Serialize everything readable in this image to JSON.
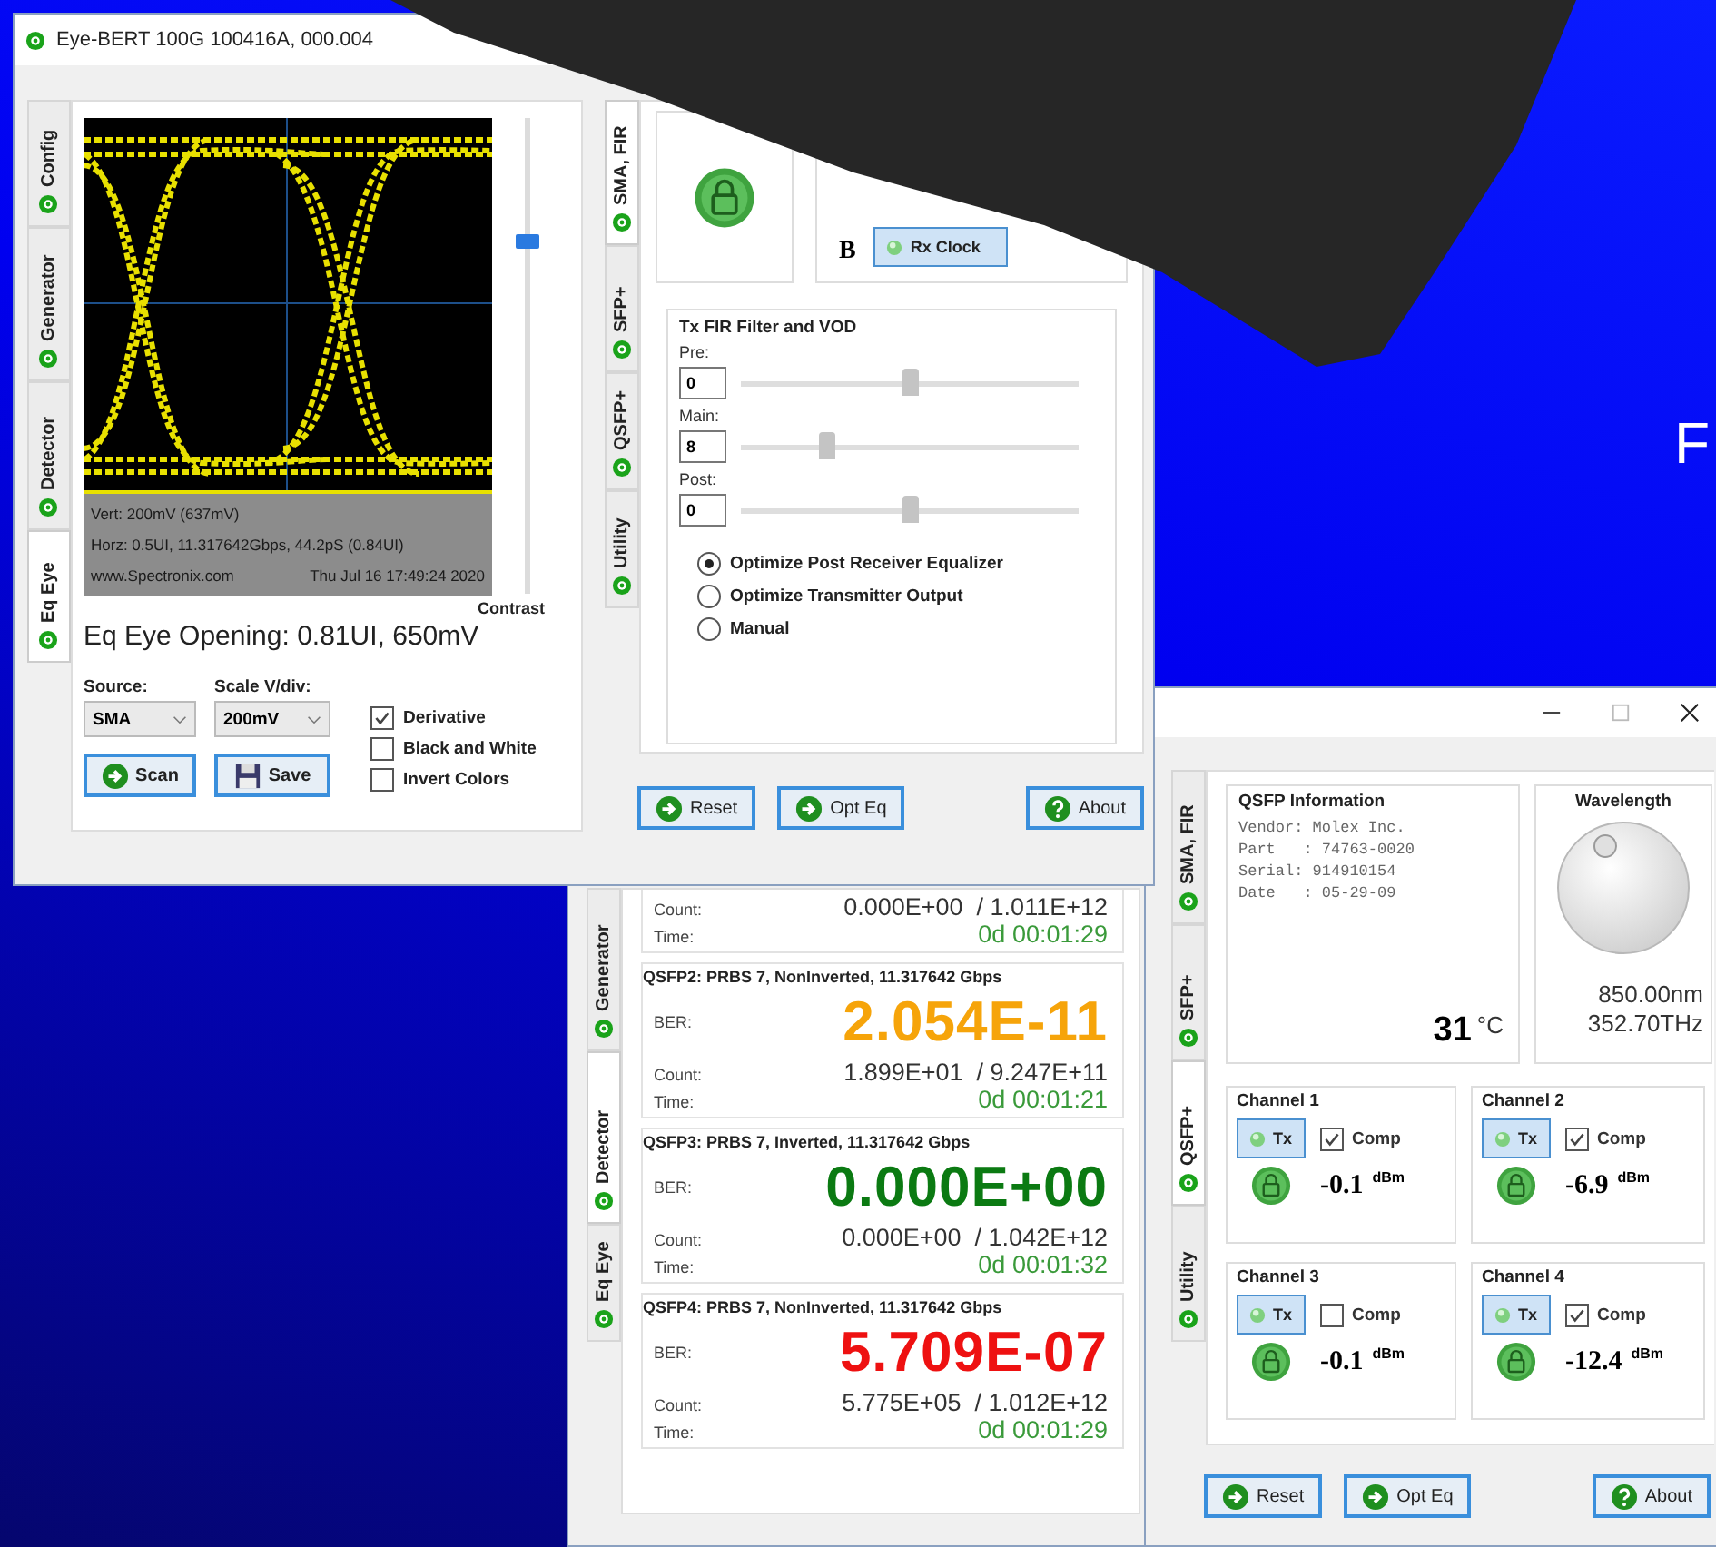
{
  "eye_bert_window": {
    "title": "Eye-BERT 100G 100416A, 000.004",
    "left_tabs": [
      {
        "label": "Config",
        "selected": false
      },
      {
        "label": "Generator",
        "selected": false
      },
      {
        "label": "Detector",
        "selected": false
      },
      {
        "label": "Eq Eye",
        "selected": true
      }
    ],
    "eye_info": [
      "Vert: 200mV (637mV)",
      "Horz: 0.5UI, 11.317642Gbps, 44.2pS (0.84UI)"
    ],
    "eye_footer": [
      "www.Spectronix.com",
      "Thu Jul 16 17:49:24 2020"
    ],
    "contrast": {
      "label": "Contrast",
      "level": 0.74
    },
    "eye_opening": "Eq Eye Opening:  0.81UI, 650mV",
    "selects": [
      {
        "label": "Source:",
        "value": "SMA"
      },
      {
        "label": "Scale V/div:",
        "value": "200mV"
      }
    ],
    "options": [
      {
        "label": "Derivative",
        "checked": true
      },
      {
        "label": "Black and White",
        "checked": false
      },
      {
        "label": "Invert Colors",
        "checked": false
      }
    ],
    "panel_buttons": [
      {
        "label": "Scan",
        "kind": "go"
      },
      {
        "label": "Save",
        "kind": "save"
      }
    ],
    "right_tabs": [
      {
        "label": "SMA, FIR",
        "selected": true
      },
      {
        "label": "SFP+",
        "selected": false
      },
      {
        "label": "QSFP+",
        "selected": false
      },
      {
        "label": "Utility",
        "selected": false
      }
    ],
    "clock": {
      "group": "B",
      "label": "Rx Clock"
    },
    "fir": {
      "title": "Tx FIR Filter and VOD",
      "sliders": [
        {
          "label": "Pre:",
          "value": "0",
          "level": 0.5
        },
        {
          "label": "Main:",
          "value": "8",
          "level": 0.25
        },
        {
          "label": "Post:",
          "value": "0",
          "level": 0.5
        }
      ],
      "modes": [
        {
          "label": "Optimize Post Receiver Equalizer",
          "selected": true
        },
        {
          "label": "Optimize Transmitter Output",
          "selected": false
        },
        {
          "label": "Manual",
          "selected": false
        }
      ]
    },
    "footer_buttons": [
      {
        "label": "Reset",
        "kind": "go"
      },
      {
        "label": "Opt Eq",
        "kind": "go"
      },
      {
        "label": "About",
        "kind": "help"
      }
    ]
  },
  "detector_window": {
    "tabs": [
      {
        "label": "Generator",
        "selected": false
      },
      {
        "label": "Detector",
        "selected": true
      },
      {
        "label": "Eq Eye",
        "selected": false
      }
    ],
    "cards": [
      {
        "count_label": "Count:",
        "count": "0.000E+00  / 1.011E+12",
        "time_label": "Time:",
        "time": "0d 00:01:29"
      },
      {
        "header": "QSFP2: PRBS 7, NonInverted, 11.317642 Gbps",
        "ber_label": "BER:",
        "ber": "2.054E-11",
        "color": "#f6a40a",
        "count_label": "Count:",
        "count": "1.899E+01  / 9.247E+11",
        "time_label": "Time:",
        "time": "0d 00:01:21"
      },
      {
        "header": "QSFP3: PRBS 7, Inverted, 11.317642 Gbps",
        "ber_label": "BER:",
        "ber": "0.000E+00",
        "color": "#0b7a12",
        "count_label": "Count:",
        "count": "0.000E+00  / 1.042E+12",
        "time_label": "Time:",
        "time": "0d 00:01:32"
      },
      {
        "header": "QSFP4: PRBS 7, NonInverted, 11.317642 Gbps",
        "ber_label": "BER:",
        "ber": "5.709E-07",
        "color": "#ee1111",
        "count_label": "Count:",
        "count": "5.775E+05  / 1.012E+12",
        "time_label": "Time:",
        "time": "0d 00:01:29"
      }
    ]
  },
  "qsfp_window": {
    "tabs": [
      {
        "label": "SMA, FIR",
        "selected": false
      },
      {
        "label": "SFP+",
        "selected": false
      },
      {
        "label": "QSFP+",
        "selected": true
      },
      {
        "label": "Utility",
        "selected": false
      }
    ],
    "info": {
      "title": "QSFP Information",
      "lines": [
        "Vendor: Molex Inc.",
        "Part   : 74763-0020",
        "Serial: 914910154",
        "Date   : 05-29-09"
      ],
      "temp": "31",
      "temp_unit": "°C"
    },
    "wavelength": {
      "title": "Wavelength",
      "nm": "850.00nm",
      "thz": "352.70THz"
    },
    "channels": [
      {
        "name": "Channel 1",
        "tx": "Tx",
        "comp": "Comp",
        "checked": true,
        "power": "-0.1",
        "unit": "dBm"
      },
      {
        "name": "Channel 2",
        "tx": "Tx",
        "comp": "Comp",
        "checked": true,
        "power": "-6.9",
        "unit": "dBm"
      },
      {
        "name": "Channel 3",
        "tx": "Tx",
        "comp": "Comp",
        "checked": false,
        "power": "-0.1",
        "unit": "dBm"
      },
      {
        "name": "Channel 4",
        "tx": "Tx",
        "comp": "Comp",
        "checked": true,
        "power": "-12.4",
        "unit": "dBm"
      }
    ],
    "buttons": [
      {
        "label": "Reset",
        "kind": "go"
      },
      {
        "label": "Opt Eq",
        "kind": "go"
      },
      {
        "label": "About",
        "kind": "help"
      }
    ]
  },
  "background_text": "F"
}
